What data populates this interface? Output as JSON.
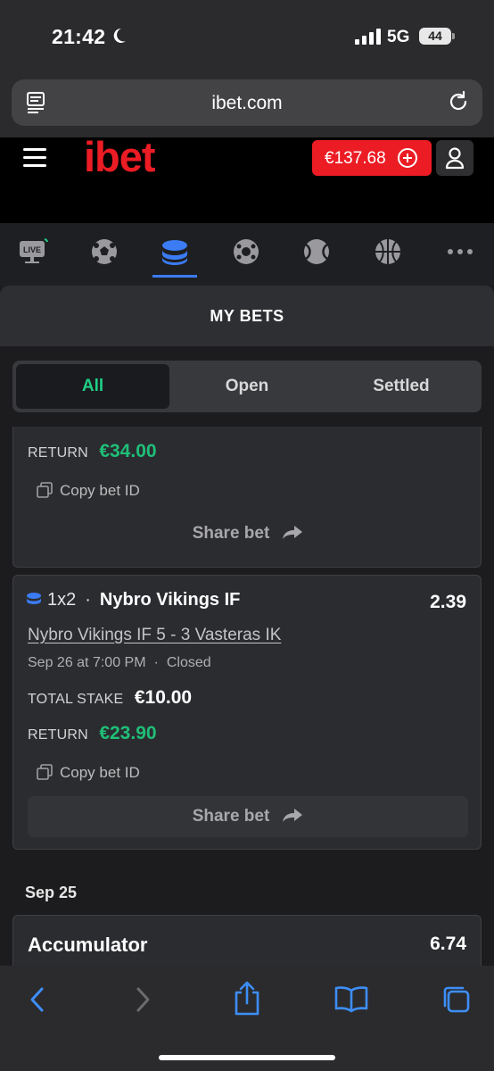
{
  "status_bar": {
    "time": "21:42",
    "network": "5G",
    "battery": "44"
  },
  "browser": {
    "url": "ibet.com"
  },
  "header": {
    "logo": "ibet",
    "balance": "€137.68"
  },
  "sport_nav": {
    "items": [
      "live-icon",
      "soccer-icon",
      "my-bets-icon",
      "ice-hockey-icon",
      "tennis-icon",
      "basketball-icon",
      "more-icon"
    ],
    "live_badge": "LIVE",
    "active": "my-bets-icon"
  },
  "page": {
    "title": "MY BETS"
  },
  "tabs": {
    "all": "All",
    "open": "Open",
    "settled": "Settled",
    "active": "All"
  },
  "bets": [
    {
      "return_label": "RETURN",
      "return_value": "€34.00",
      "copy_label": "Copy bet ID",
      "share_label": "Share bet"
    },
    {
      "market": "1x2",
      "dot": "·",
      "selection": "Nybro Vikings IF",
      "odds": "2.39",
      "event": "Nybro Vikings IF 5 - 3 Vasteras IK",
      "datetime": "Sep 26 at 7:00 PM",
      "status": "Closed",
      "stake_label": "TOTAL STAKE",
      "stake_value": "€10.00",
      "return_label": "RETURN",
      "return_value": "€23.90",
      "copy_label": "Copy bet ID",
      "share_label": "Share bet"
    }
  ],
  "date_group": "Sep 25",
  "accumulator": {
    "label": "Accumulator",
    "odds": "6.74"
  },
  "colors": {
    "brand_red": "#ec1c24",
    "accent_green": "#1fbf78",
    "accent_blue": "#3b7bf3",
    "ios_blue": "#3d8ef8"
  },
  "toolbar": [
    "back-icon",
    "forward-icon",
    "share-icon",
    "bookmarks-icon",
    "tabs-icon"
  ]
}
